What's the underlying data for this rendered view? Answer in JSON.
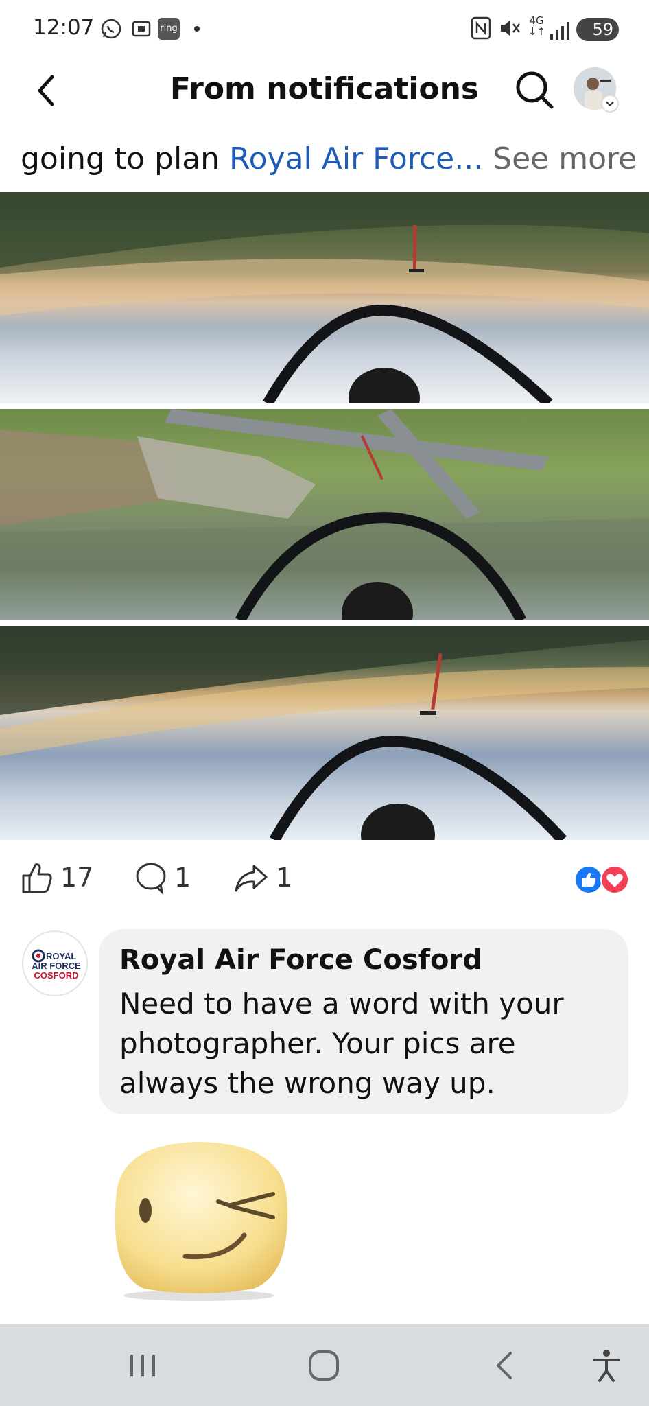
{
  "status_bar": {
    "time": "12:07",
    "ring_label": "ring",
    "network": "4G",
    "battery": "59",
    "icons": [
      "whatsapp-icon",
      "screenshot-icon",
      "ring-icon",
      "nfc-icon",
      "mute-icon",
      "signal-icon",
      "battery-icon"
    ]
  },
  "header": {
    "title": "From notifications",
    "back_icon": "back-chevron-icon",
    "search_icon": "search-icon"
  },
  "post": {
    "caption_prefix": "going to plan ",
    "caption_link": "Royal Air Force",
    "caption_ellipsis": "...",
    "see_more": " See more",
    "photos": [
      {
        "description_icon": "inverted-cockpit-photo"
      },
      {
        "description_icon": "inverted-airfield-photo"
      },
      {
        "description_icon": "inverted-clouds-photo"
      }
    ],
    "likes_count": "17",
    "comments_count": "1",
    "shares_count": "1",
    "reaction_icons": [
      "like-reaction-icon",
      "love-reaction-icon"
    ]
  },
  "comment": {
    "avatar_lines": [
      "ROYAL",
      "AIR FORCE",
      "COSFORD"
    ],
    "author": "Royal Air Force Cosford",
    "text": "Need to have a word with your photographer. Your pics are always the wrong way up.",
    "sticker": "wink-sticker"
  },
  "colors": {
    "link": "#1e5bb7",
    "like_blue": "#1877f2",
    "love_red": "#f33e58",
    "navbar_bg": "#d9dcdf"
  }
}
